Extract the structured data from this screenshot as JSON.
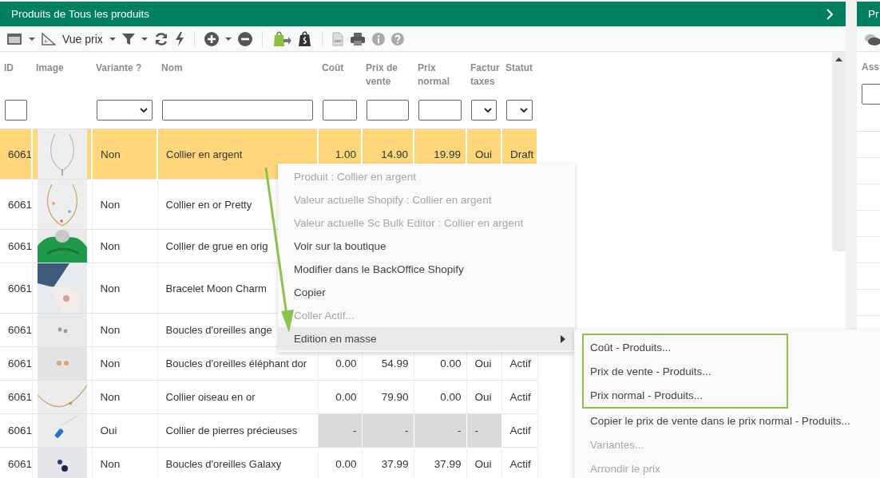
{
  "left_panel": {
    "title": "Produits de Tous les produits",
    "view_label": "Vue prix",
    "columns": [
      {
        "label": "ID",
        "kind": "text"
      },
      {
        "label": "Image",
        "kind": "none"
      },
      {
        "label": "Variante ?",
        "kind": "select"
      },
      {
        "label": "Nom",
        "kind": "text"
      },
      {
        "label": "Coût",
        "kind": "text"
      },
      {
        "label": "Prix de vente",
        "kind": "text"
      },
      {
        "label": "Prix normal",
        "kind": "text"
      },
      {
        "label": "Factur taxes",
        "kind": "select"
      },
      {
        "label": "Statut",
        "kind": "select"
      }
    ],
    "rows": [
      {
        "id": "6061",
        "variant": "Non",
        "name": "Collier en argent",
        "cost": "1.00",
        "sale_price": "14.90",
        "regular_price": "19.99",
        "taxable": "Oui",
        "status": "Draft",
        "selected": true,
        "locked": false
      },
      {
        "id": "6061",
        "variant": "Non",
        "name": "Collier en or Pretty",
        "selected": false,
        "locked": false
      },
      {
        "id": "6061",
        "variant": "Non",
        "name": "Collier de grue en orig",
        "selected": false,
        "locked": false
      },
      {
        "id": "6061",
        "variant": "Non",
        "name": "Bracelet Moon Charm",
        "selected": false,
        "locked": false
      },
      {
        "id": "6061",
        "variant": "Non",
        "name": "Boucles d'oreilles ange",
        "selected": false,
        "locked": false
      },
      {
        "id": "6061",
        "variant": "Non",
        "name": "Boucles d'oreilles éléphant dor",
        "cost": "0.00",
        "sale_price": "54.99",
        "regular_price": "0.00",
        "taxable": "Oui",
        "status": "Actif",
        "selected": false,
        "locked": false
      },
      {
        "id": "6061",
        "variant": "Non",
        "name": "Collier oiseau en or",
        "cost": "0.00",
        "sale_price": "79.90",
        "regular_price": "0.00",
        "taxable": "Oui",
        "status": "Actif",
        "selected": false,
        "locked": false
      },
      {
        "id": "6061",
        "variant": "Oui",
        "name": "Collier de pierres précieuses",
        "cost": "-",
        "sale_price": "-",
        "regular_price": "-",
        "taxable": "-",
        "status": "Actif",
        "selected": false,
        "locked": true
      },
      {
        "id": "6061",
        "variant": "Non",
        "name": "Boucles d'oreilles Galaxy",
        "cost": "0.00",
        "sale_price": "37.99",
        "regular_price": "37.99",
        "taxable": "Oui",
        "status": "Actif",
        "selected": false,
        "locked": false
      }
    ]
  },
  "right_panel": {
    "title": "Pr",
    "column": "Ass"
  },
  "context_menu": {
    "items": [
      {
        "label": "Produit : Collier en argent",
        "disabled": true,
        "highlighted": false,
        "submenu": false
      },
      {
        "label": "Valeur actuelle Shopify : Collier en argent",
        "disabled": true,
        "highlighted": false,
        "submenu": false
      },
      {
        "label": "Valeur actuelle Sc Bulk Editor : Collier en argent",
        "disabled": true,
        "highlighted": false,
        "submenu": false
      },
      {
        "label": "Voir sur la boutique",
        "disabled": false,
        "highlighted": false,
        "submenu": false
      },
      {
        "label": "Modifier dans le BackOffice Shopify",
        "disabled": false,
        "highlighted": false,
        "submenu": false
      },
      {
        "label": "Copier",
        "disabled": false,
        "highlighted": false,
        "submenu": false
      },
      {
        "label": "Coller Actif...",
        "disabled": true,
        "highlighted": false,
        "submenu": false
      },
      {
        "label": "Edition en masse",
        "disabled": false,
        "highlighted": true,
        "submenu": true
      }
    ]
  },
  "submenu": {
    "items": [
      {
        "label": "Coût - Produits...",
        "disabled": false,
        "outlined": true
      },
      {
        "label": "Prix de vente - Produits...",
        "disabled": false,
        "outlined": true
      },
      {
        "label": "Prix normal - Produits...",
        "disabled": false,
        "outlined": true
      },
      {
        "label": "Copier le prix de vente dans le prix normal - Produits...",
        "disabled": false,
        "outlined": false
      },
      {
        "label": "Variantes...",
        "disabled": true,
        "outlined": false
      },
      {
        "label": "Arrondir le prix",
        "disabled": true,
        "outlined": false
      }
    ]
  }
}
